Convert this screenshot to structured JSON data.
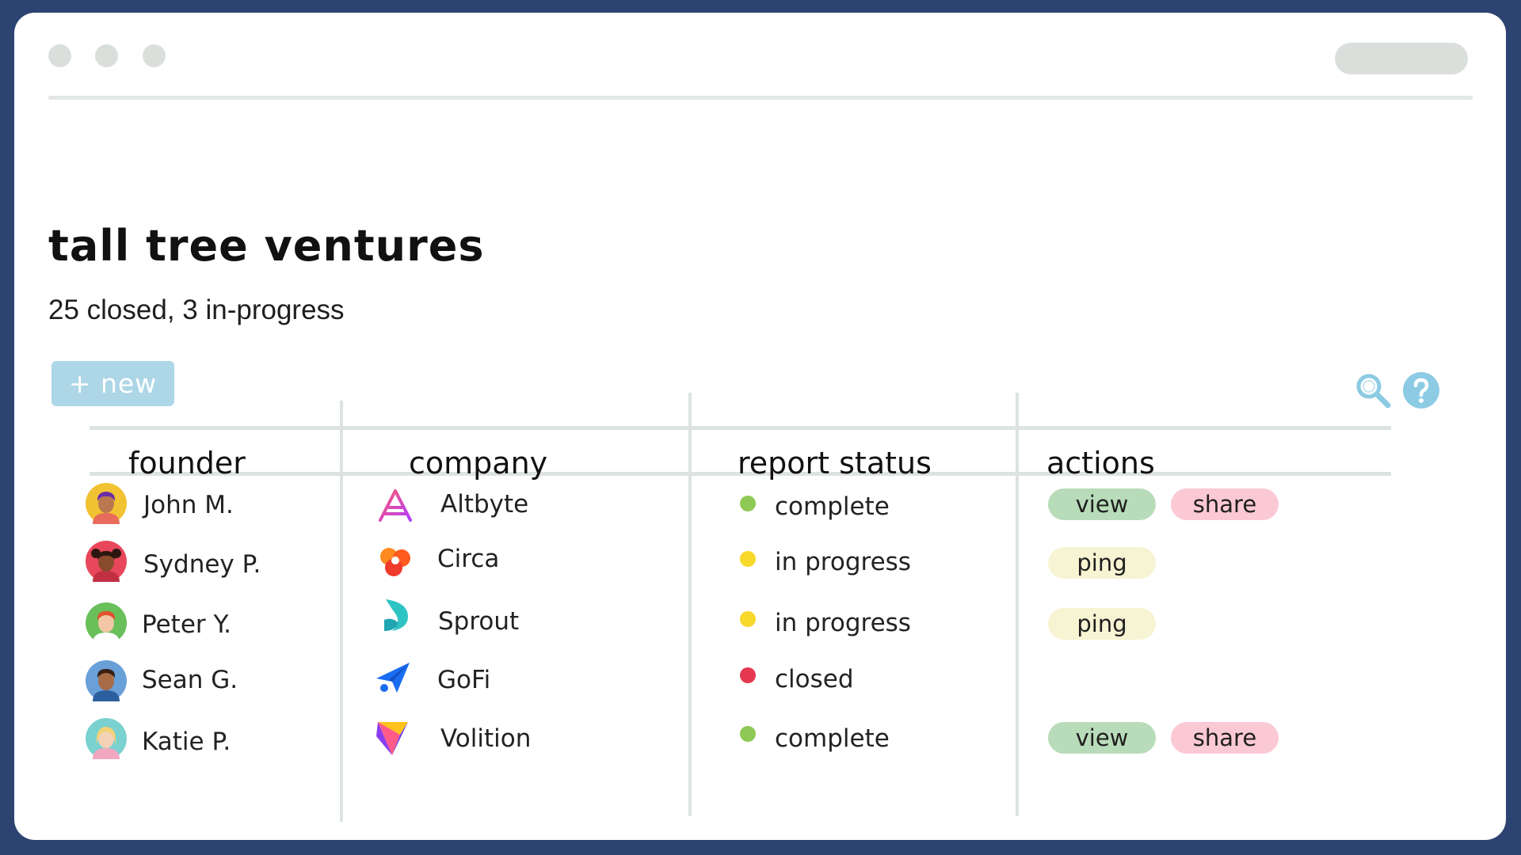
{
  "window": {
    "controls": [
      "window-dot",
      "window-dot",
      "window-dot"
    ]
  },
  "header": {
    "title": "tall tree ventures",
    "subtitle": "25 closed, 3 in-progress",
    "new_button": "+ new"
  },
  "table": {
    "columns": [
      "founder",
      "company",
      "report status",
      "actions"
    ],
    "rows": [
      {
        "founder": "John M.",
        "avatar": "avatar-john",
        "company": "Altbyte",
        "logo": "altbyte-logo-icon",
        "status": "complete",
        "status_color": "#8fc955",
        "actions": [
          "view",
          "share"
        ]
      },
      {
        "founder": "Sydney P.",
        "avatar": "avatar-sydney",
        "company": "Circa",
        "logo": "circa-logo-icon",
        "status": "in progress",
        "status_color": "#f7d82b",
        "actions": [
          "ping"
        ]
      },
      {
        "founder": "Peter Y.",
        "avatar": "avatar-peter",
        "company": "Sprout",
        "logo": "sprout-logo-icon",
        "status": "in progress",
        "status_color": "#f7d82b",
        "actions": [
          "ping"
        ]
      },
      {
        "founder": "Sean G.",
        "avatar": "avatar-sean",
        "company": "GoFi",
        "logo": "gofi-logo-icon",
        "status": "closed",
        "status_color": "#e5384f",
        "actions": []
      },
      {
        "founder": "Katie P.",
        "avatar": "avatar-katie",
        "company": "Volition",
        "logo": "volition-logo-icon",
        "status": "complete",
        "status_color": "#8fc955",
        "actions": [
          "view",
          "share"
        ]
      }
    ]
  },
  "colors": {
    "frame": "#2d4372",
    "new_button": "#add6e6",
    "icon_accent": "#8ccbe3",
    "view_pill": "#b8dcb9",
    "share_pill": "#fbc9d4",
    "ping_pill": "#f6f4d2"
  },
  "icons": {
    "search": "search-icon",
    "help": "help-icon"
  }
}
